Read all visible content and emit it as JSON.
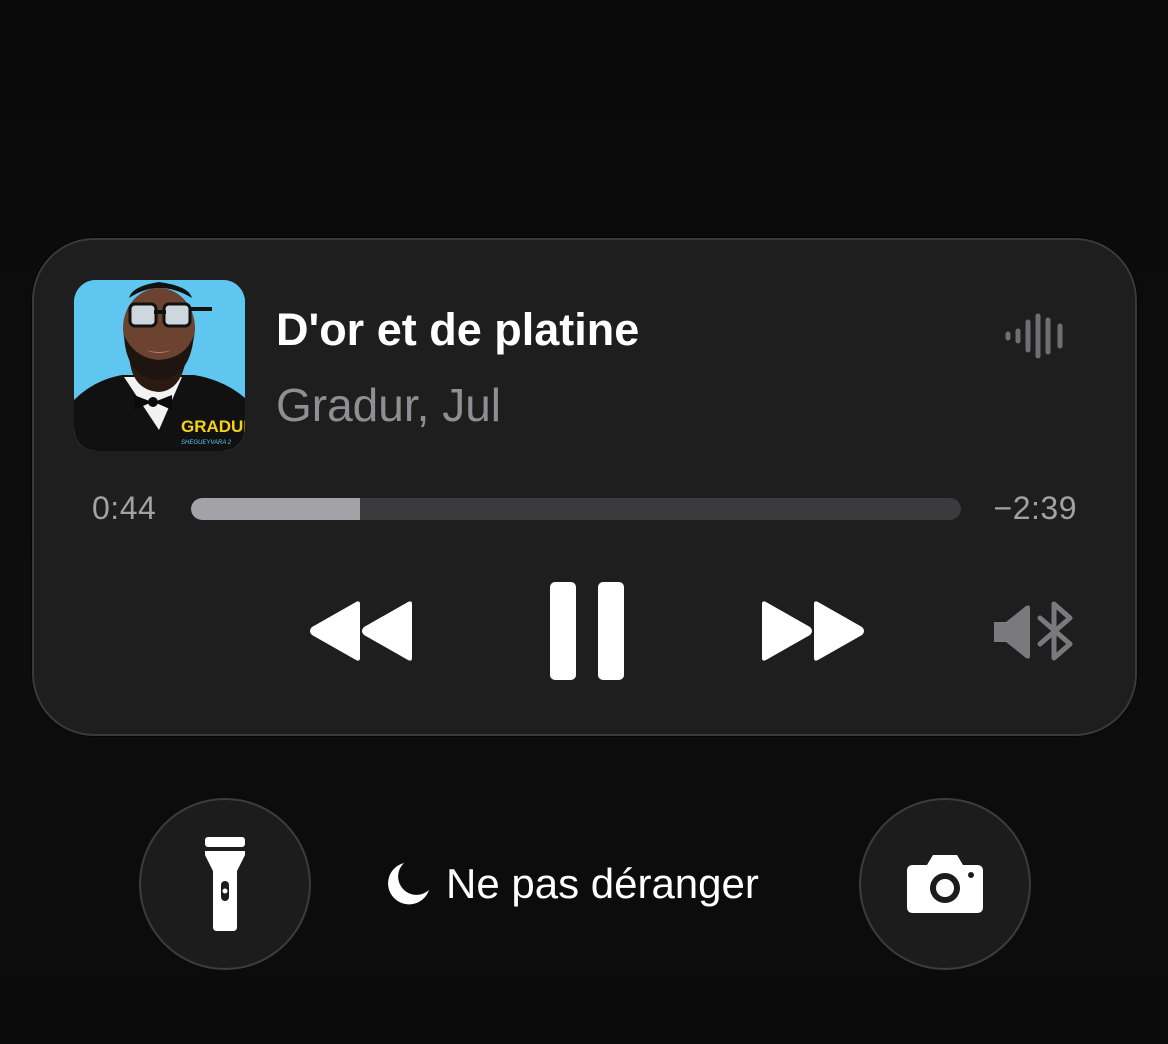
{
  "now_playing": {
    "title": "D'or et de platine",
    "artist": "Gradur, Jul",
    "artwork": {
      "description_icon": "album-artwork",
      "text_main": "GRADUR",
      "text_sub": "SHEGUEYVARA 2"
    },
    "elapsed": "0:44",
    "remaining": "−2:39",
    "progress_fraction": 0.22,
    "controls": {
      "previous_icon": "rewind-icon",
      "pause_icon": "pause-icon",
      "next_icon": "fast-forward-icon",
      "audio_output_icon": "speaker-bluetooth-icon",
      "waveform_icon": "waveform-icon"
    }
  },
  "bottom": {
    "flashlight_icon": "flashlight-icon",
    "camera_icon": "camera-icon",
    "focus_icon": "moon-icon",
    "focus_label": "Ne pas déranger"
  },
  "colors": {
    "background": "#0b0b0b",
    "card": "#1e1e1f",
    "secondary_text": "#8e8e93",
    "progress_track": "#3b3b3e",
    "progress_fill": "#a2a2a7",
    "artwork_sky": "#5fc7ef",
    "artwork_yellow": "#f3d21a"
  }
}
